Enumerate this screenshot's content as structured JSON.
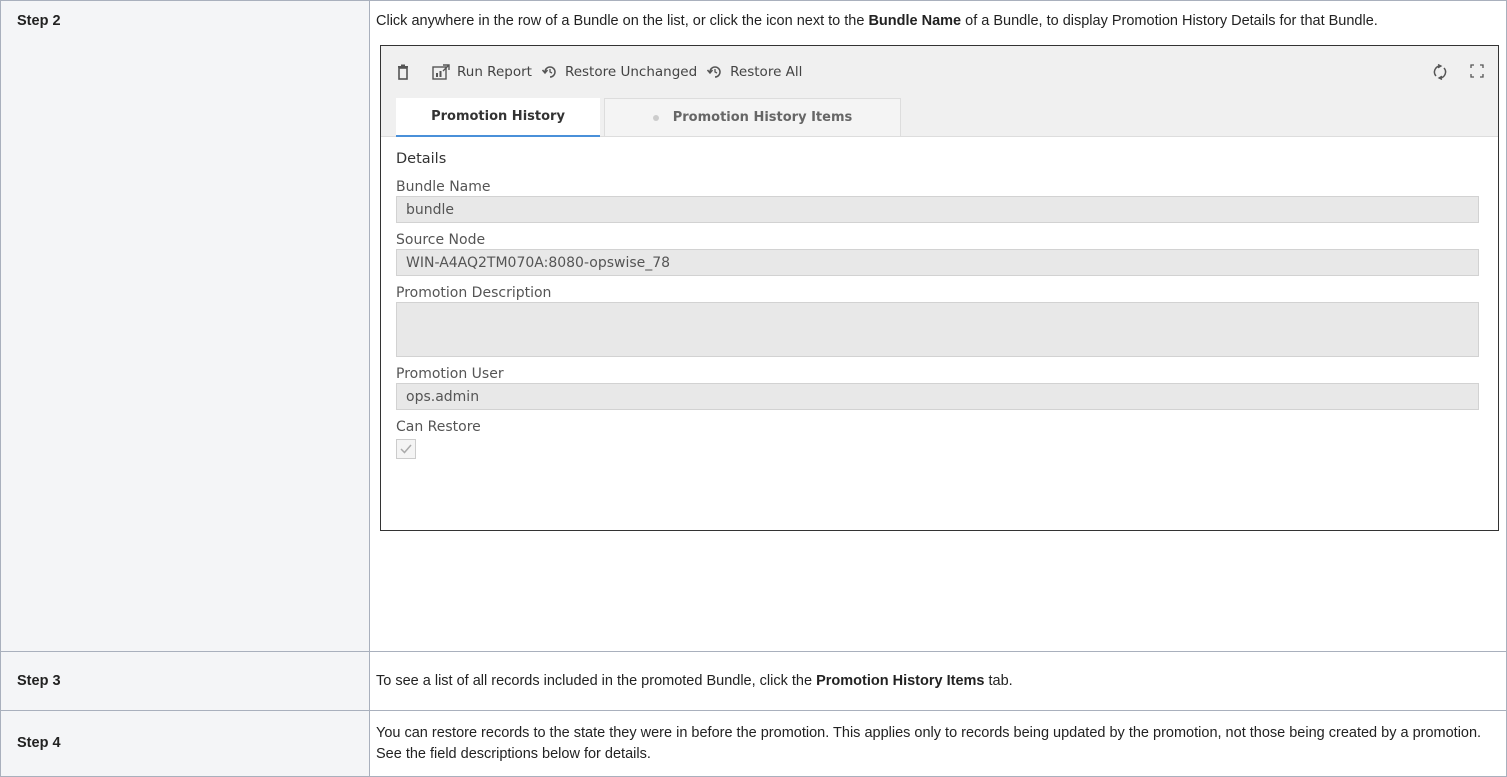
{
  "steps": [
    {
      "label": "Step 2",
      "text_before": "Click anywhere in the row of a Bundle on the list, or click the icon next to the ",
      "text_bold": "Bundle Name",
      "text_after": " of a Bundle, to display Promotion History Details for that Bundle."
    },
    {
      "label": "Step 3",
      "text_before": "To see a list of all records included in the promoted Bundle, click the ",
      "text_bold": "Promotion History Items",
      "text_after": " tab."
    },
    {
      "label": "Step 4",
      "text": "You can restore records to the state they were in before the promotion. This applies only to records being updated by the promotion, not those being created by a promotion. See the field descriptions below for details."
    }
  ],
  "screenshot": {
    "toolbar": {
      "delete_icon": "trash-icon",
      "run_report_label": "Run Report",
      "restore_unchanged_label": "Restore Unchanged",
      "restore_all_label": "Restore All",
      "refresh_icon": "refresh-icon",
      "maximize_icon": "maximize-icon"
    },
    "tabs": [
      {
        "label": "Promotion History",
        "active": true
      },
      {
        "label": "Promotion History Items",
        "active": false
      }
    ],
    "section_title": "Details",
    "fields": {
      "bundle_name_label": "Bundle Name",
      "bundle_name_value": "bundle",
      "source_node_label": "Source Node",
      "source_node_value": "WIN-A4AQ2TM070A:8080-opswise_78",
      "promotion_description_label": "Promotion Description",
      "promotion_description_value": "",
      "promotion_user_label": "Promotion User",
      "promotion_user_value": "ops.admin",
      "can_restore_label": "Can Restore",
      "can_restore_checked": true
    }
  }
}
